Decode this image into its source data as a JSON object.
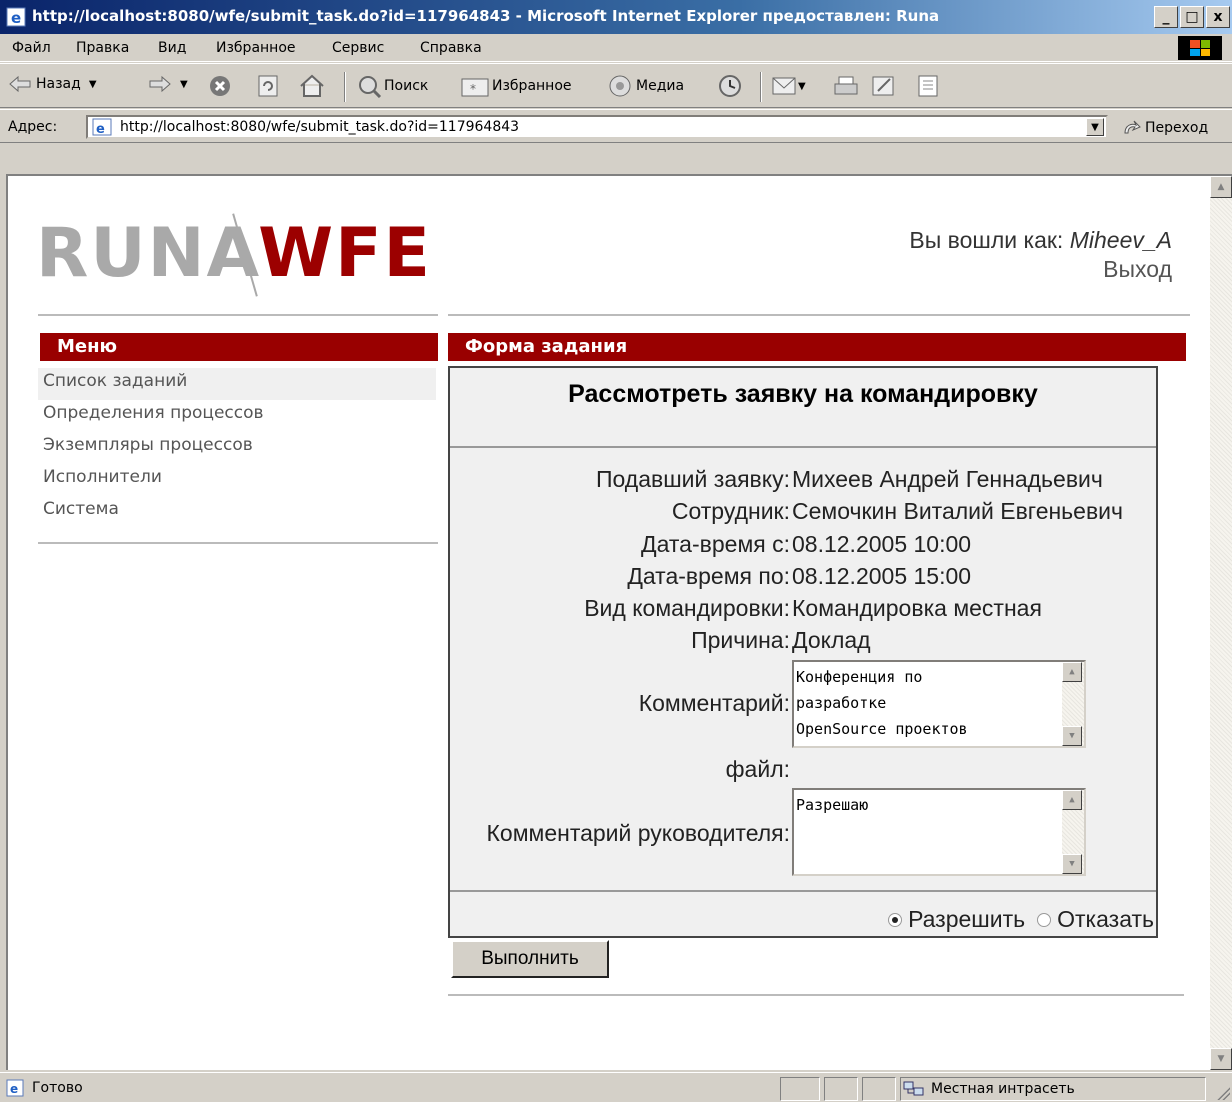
{
  "window": {
    "title": "http://localhost:8080/wfe/submit_task.do?id=117964843 - Microsoft Internet Explorer предоставлен: Runa",
    "buttons": [
      "_",
      "□",
      "x"
    ]
  },
  "menubar": {
    "items": [
      "Файл",
      "Правка",
      "Вид",
      "Избранное",
      "Сервис",
      "Справка"
    ]
  },
  "toolbar": {
    "back": "Назад",
    "search": "Поиск",
    "favorites": "Избранное",
    "media": "Медиа"
  },
  "address": {
    "label": "Адрес:",
    "url": "http://localhost:8080/wfe/submit_task.do?id=117964843",
    "go": "Переход"
  },
  "page": {
    "logo_left": "RUNA",
    "logo_right": "WFE",
    "login_prefix": "Вы вошли как:",
    "login_user": "Miheev_A",
    "logout": "Выход",
    "menu_title": "Меню",
    "menu_items": [
      "Список заданий",
      "Определения процессов",
      "Экземпляры процессов",
      "Исполнители",
      "Система"
    ],
    "form_header": "Форма задания",
    "form_title": "Рассмотреть заявку на командировку",
    "fields": [
      {
        "label": "Подавший заявку:",
        "value": "Михеев Андрей Геннадьевич"
      },
      {
        "label": "Сотрудник:",
        "value": "Семочкин Виталий Евгеньевич"
      },
      {
        "label": "Дата-время с:",
        "value": "08.12.2005 10:00"
      },
      {
        "label": "Дата-время по:",
        "value": "08.12.2005 15:00"
      },
      {
        "label": "Вид командировки:",
        "value": "Командировка местная"
      },
      {
        "label": "Причина:",
        "value": "Доклад"
      }
    ],
    "comment_label": "Комментарий:",
    "comment_text": "Конференция по\nразработке\nOpenSource проектов",
    "file_label": "файл:",
    "manager_comment_label": "Комментарий руководителя:",
    "manager_comment_text": "Разрешаю",
    "decision": {
      "allow": "Разрешить",
      "deny": "Отказать",
      "selected": "allow"
    },
    "submit": "Выполнить"
  },
  "status": {
    "text": "Готово",
    "zone": "Местная интрасеть"
  },
  "colors": {
    "accent": "#990000",
    "titlebar": "#0a246a",
    "chrome": "#d4d0c8"
  }
}
